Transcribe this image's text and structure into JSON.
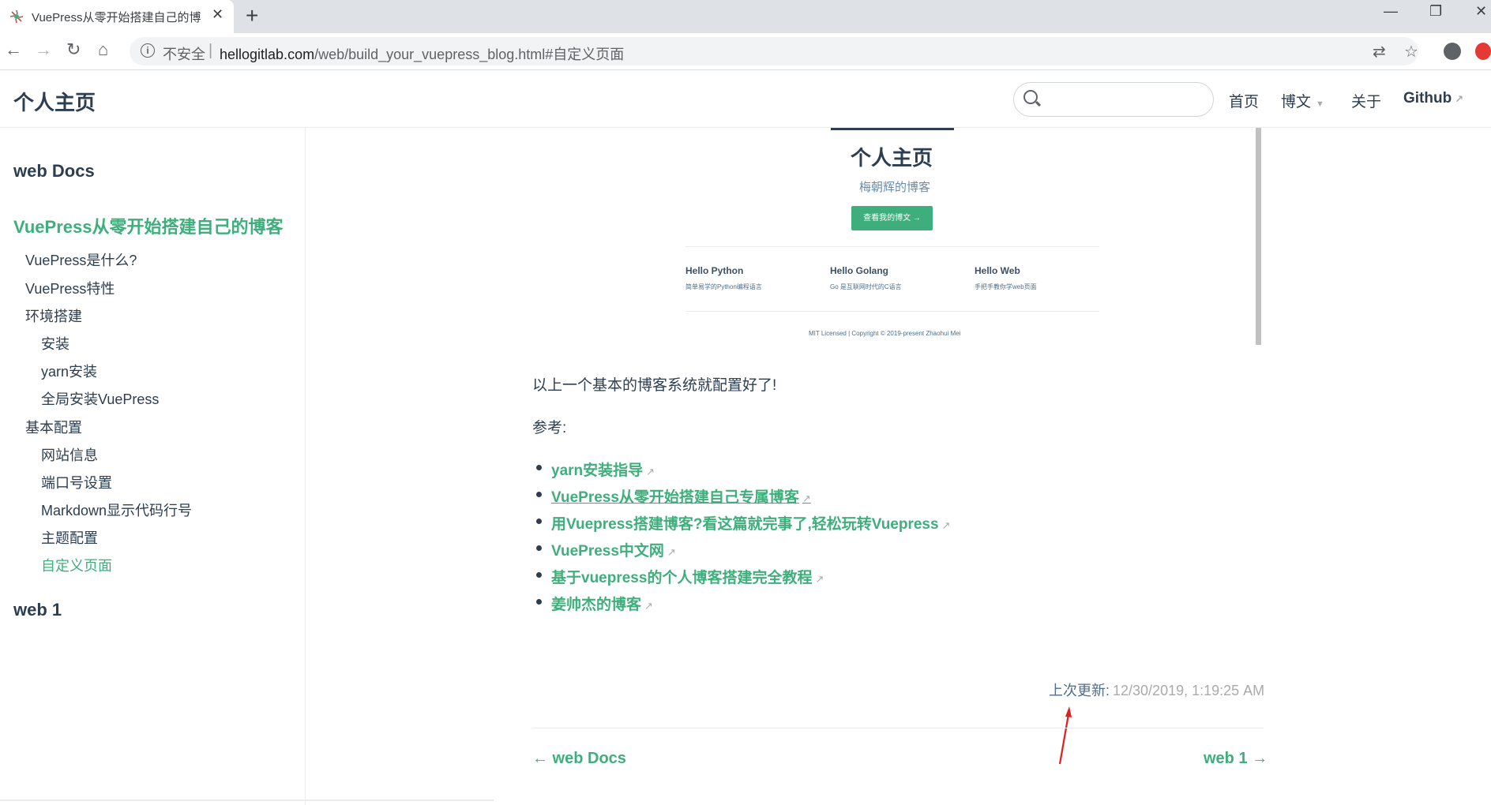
{
  "browser": {
    "tab_title": "VuePress从零开始搭建自己的博",
    "tab_close": "✕",
    "new_tab": "+",
    "security_label": "不安全",
    "url_host": "hellogitlab.com",
    "url_path": "/web/build_your_vuepress_blog.html#自定义页面"
  },
  "navbar": {
    "site_title": "个人主页",
    "links": [
      "首页",
      "博文",
      "关于",
      "Github"
    ]
  },
  "sidebar": {
    "group1": "web Docs",
    "page_title": "VuePress从零开始搭建自己的博客",
    "items": [
      {
        "label": "VuePress是什么?",
        "level": 2
      },
      {
        "label": "VuePress特性",
        "level": 2
      },
      {
        "label": "环境搭建",
        "level": 2
      },
      {
        "label": "安装",
        "level": 3
      },
      {
        "label": "yarn安装",
        "level": 3
      },
      {
        "label": "全局安装VuePress",
        "level": 3
      },
      {
        "label": "基本配置",
        "level": 2
      },
      {
        "label": "网站信息",
        "level": 3
      },
      {
        "label": "端口号设置",
        "level": 3
      },
      {
        "label": "Markdown显示代码行号",
        "level": 3
      },
      {
        "label": "主题配置",
        "level": 3
      },
      {
        "label": "自定义页面",
        "level": 3,
        "active": true
      }
    ],
    "group2": "web 1"
  },
  "preview": {
    "hero_title": "个人主页",
    "tagline": "梅朝辉的博客",
    "action": "查看我的博文 →",
    "features": [
      {
        "title": "Hello Python",
        "details": "简单易学的Python编程语言"
      },
      {
        "title": "Hello Golang",
        "details": "Go 是互联网时代的C语言"
      },
      {
        "title": "Hello Web",
        "details": "手把手教你学web页面"
      }
    ],
    "footer": "MIT Licensed | Copyright © 2019-present Zhaohui Mei"
  },
  "content": {
    "para1": "以上一个基本的博客系统就配置好了!",
    "para2": "参考:",
    "references": [
      "yarn安装指导",
      "VuePress从零开始搭建自己专属博客",
      "用Vuepress搭建博客?看这篇就完事了,轻松玩转Vuepress",
      "VuePress中文网",
      "基于vuepress的个人博客搭建完全教程",
      "姜帅杰的博客"
    ],
    "last_updated_label": "上次更新:",
    "last_updated_value": "12/30/2019, 1:19:25 AM",
    "prev": "← web Docs",
    "next": "web 1 →"
  },
  "colors": {
    "accent": "#3eaf7c",
    "text": "#2c3e50",
    "annotation_arrow": "#e02020"
  }
}
